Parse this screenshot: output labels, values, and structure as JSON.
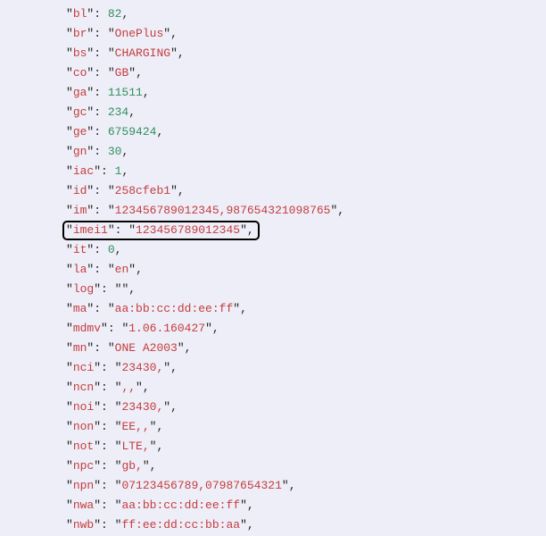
{
  "lines": [
    {
      "key": "bl",
      "type": "num",
      "value": "82"
    },
    {
      "key": "br",
      "type": "str",
      "value": "OnePlus"
    },
    {
      "key": "bs",
      "type": "str",
      "value": "CHARGING"
    },
    {
      "key": "co",
      "type": "str",
      "value": "GB"
    },
    {
      "key": "ga",
      "type": "num",
      "value": "11511"
    },
    {
      "key": "gc",
      "type": "num",
      "value": "234"
    },
    {
      "key": "ge",
      "type": "num",
      "value": "6759424"
    },
    {
      "key": "gn",
      "type": "num",
      "value": "30"
    },
    {
      "key": "iac",
      "type": "num",
      "value": "1"
    },
    {
      "key": "id",
      "type": "str",
      "value": "258cfeb1"
    },
    {
      "key": "im",
      "type": "str",
      "value": "123456789012345,987654321098765"
    },
    {
      "key": "imei1",
      "type": "str",
      "value": "123456789012345",
      "highlight": true
    },
    {
      "key": "it",
      "type": "num",
      "value": "0"
    },
    {
      "key": "la",
      "type": "str",
      "value": "en"
    },
    {
      "key": "log",
      "type": "str",
      "value": ""
    },
    {
      "key": "ma",
      "type": "str",
      "value": "aa:bb:cc:dd:ee:ff"
    },
    {
      "key": "mdmv",
      "type": "str",
      "value": "1.06.160427"
    },
    {
      "key": "mn",
      "type": "str",
      "value": "ONE A2003"
    },
    {
      "key": "nci",
      "type": "str",
      "value": "23430,"
    },
    {
      "key": "ncn",
      "type": "str",
      "value": ",,"
    },
    {
      "key": "noi",
      "type": "str",
      "value": "23430,"
    },
    {
      "key": "non",
      "type": "str",
      "value": "EE,,"
    },
    {
      "key": "not",
      "type": "str",
      "value": "LTE,"
    },
    {
      "key": "npc",
      "type": "str",
      "value": "gb,"
    },
    {
      "key": "npn",
      "type": "str",
      "value": "07123456789,07987654321"
    },
    {
      "key": "nwa",
      "type": "str",
      "value": "aa:bb:cc:dd:ee:ff"
    },
    {
      "key": "nwb",
      "type": "str",
      "value": "ff:ee:dd:cc:bb:aa"
    }
  ]
}
